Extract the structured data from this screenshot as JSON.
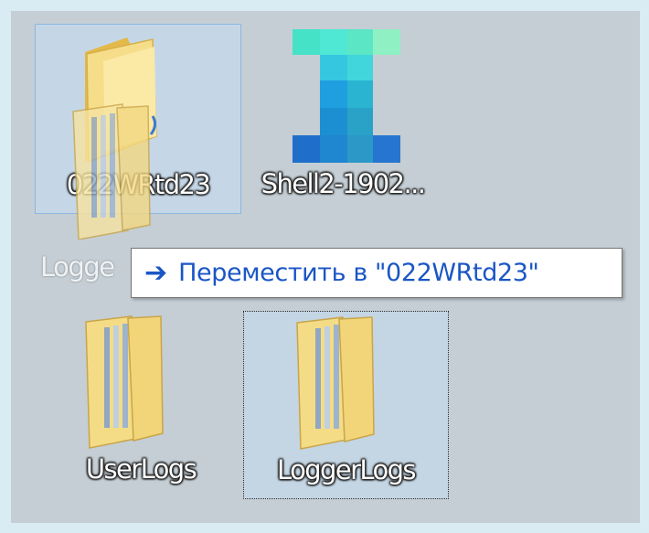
{
  "desktop": {
    "items": [
      {
        "name": "022WRtd23",
        "icon": "folder-icon",
        "state": "selected"
      },
      {
        "name": "Shell2-1902...",
        "icon": "app-pixel-icon"
      },
      {
        "name": "UserLogs",
        "icon": "folder-icon"
      },
      {
        "name": "LoggerLogs",
        "icon": "folder-icon",
        "state": "focused"
      }
    ],
    "drag_ghost_label": "Logge"
  },
  "tooltip": {
    "arrow": "➔",
    "text": "Переместить в \"022WRtd23\"",
    "icon": "move-arrow-icon"
  },
  "colors": {
    "frame": "#d9ecf3",
    "desktop": "#c4ced4",
    "selection": "#c6def6",
    "tooltip_text": "#1a56c5",
    "folder": "#f2d67a"
  }
}
